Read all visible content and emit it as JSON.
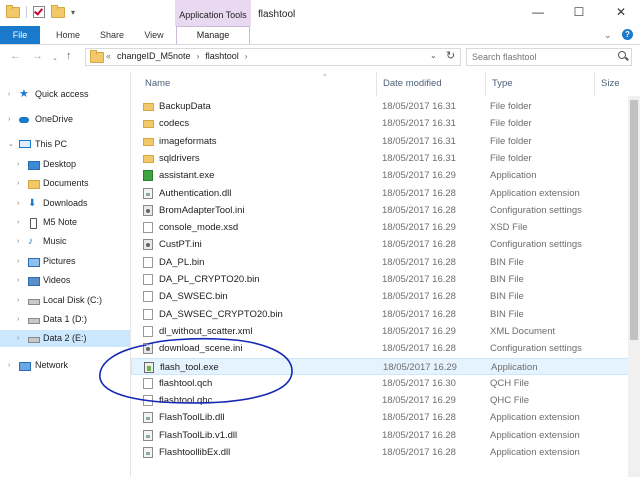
{
  "window": {
    "title": "flashtool",
    "contextual_tab_group": "Application Tools",
    "minimize": "—",
    "maximize": "☐",
    "close": "✕"
  },
  "ribbon": {
    "tabs": [
      "File",
      "Home",
      "Share",
      "View",
      "Manage"
    ]
  },
  "address": {
    "overflow": "«",
    "crumbs": [
      "changeID_M5note",
      "flashtool"
    ],
    "current": "flashtool",
    "search_placeholder": "Search flashtool"
  },
  "nav_pane": {
    "items": [
      {
        "label": "Quick access",
        "icon": "quick-access-star-icon"
      },
      {
        "label": "OneDrive",
        "icon": "onedrive-cloud-icon"
      },
      {
        "label": "This PC",
        "icon": "this-pc-icon"
      },
      {
        "label": "Desktop",
        "icon": "desktop-folder-icon"
      },
      {
        "label": "Documents",
        "icon": "documents-folder-icon"
      },
      {
        "label": "Downloads",
        "icon": "downloads-icon"
      },
      {
        "label": "M5 Note",
        "icon": "phone-device-icon"
      },
      {
        "label": "Music",
        "icon": "music-icon"
      },
      {
        "label": "Pictures",
        "icon": "pictures-folder-icon"
      },
      {
        "label": "Videos",
        "icon": "videos-folder-icon"
      },
      {
        "label": "Local Disk (C:)",
        "icon": "local-disk-icon"
      },
      {
        "label": "Data 1 (D:)",
        "icon": "drive-icon"
      },
      {
        "label": "Data 2 (E:)",
        "icon": "drive-icon"
      },
      {
        "label": "Network",
        "icon": "network-icon"
      }
    ],
    "selected": "Data 2 (E:)"
  },
  "columns": {
    "name": "Name",
    "date": "Date modified",
    "type": "Type",
    "size": "Size"
  },
  "files": [
    {
      "name": "BackupData",
      "date": "18/05/2017 16.31",
      "type": "File folder",
      "icon": "folder-icon"
    },
    {
      "name": "codecs",
      "date": "18/05/2017 16.31",
      "type": "File folder",
      "icon": "folder-icon"
    },
    {
      "name": "imageformats",
      "date": "18/05/2017 16.31",
      "type": "File folder",
      "icon": "folder-icon"
    },
    {
      "name": "sqldrivers",
      "date": "18/05/2017 16.31",
      "type": "File folder",
      "icon": "folder-icon"
    },
    {
      "name": "assistant.exe",
      "date": "18/05/2017 16.29",
      "type": "Application",
      "icon": "qt-app-icon"
    },
    {
      "name": "Authentication.dll",
      "date": "18/05/2017 16.28",
      "type": "Application extension",
      "icon": "dll-icon"
    },
    {
      "name": "BromAdapterTool.ini",
      "date": "18/05/2017 16.28",
      "type": "Configuration settings",
      "icon": "ini-settings-icon"
    },
    {
      "name": "console_mode.xsd",
      "date": "18/05/2017 16.29",
      "type": "XSD File",
      "icon": "file-icon"
    },
    {
      "name": "CustPT.ini",
      "date": "18/05/2017 16.28",
      "type": "Configuration settings",
      "icon": "ini-settings-icon"
    },
    {
      "name": "DA_PL.bin",
      "date": "18/05/2017 16.28",
      "type": "BIN File",
      "icon": "file-icon"
    },
    {
      "name": "DA_PL_CRYPTO20.bin",
      "date": "18/05/2017 16.28",
      "type": "BIN File",
      "icon": "file-icon"
    },
    {
      "name": "DA_SWSEC.bin",
      "date": "18/05/2017 16.28",
      "type": "BIN File",
      "icon": "file-icon"
    },
    {
      "name": "DA_SWSEC_CRYPTO20.bin",
      "date": "18/05/2017 16.28",
      "type": "BIN File",
      "icon": "file-icon"
    },
    {
      "name": "dl_without_scatter.xml",
      "date": "18/05/2017 16.29",
      "type": "XML Document",
      "icon": "file-icon"
    },
    {
      "name": "download_scene.ini",
      "date": "18/05/2017 16.28",
      "type": "Configuration settings",
      "icon": "ini-settings-icon"
    },
    {
      "name": "flash_tool.exe",
      "date": "18/05/2017 16.29",
      "type": "Application",
      "icon": "flash-tool-exe-icon"
    },
    {
      "name": "flashtool.qch",
      "date": "18/05/2017 16.30",
      "type": "QCH File",
      "icon": "file-icon"
    },
    {
      "name": "flashtool.qhc",
      "date": "18/05/2017 16.29",
      "type": "QHC File",
      "icon": "file-icon"
    },
    {
      "name": "FlashToolLib.dll",
      "date": "18/05/2017 16.28",
      "type": "Application extension",
      "icon": "dll-icon"
    },
    {
      "name": "FlashToolLib.v1.dll",
      "date": "18/05/2017 16.28",
      "type": "Application extension",
      "icon": "dll-icon"
    },
    {
      "name": "FlashtoollibEx.dll",
      "date": "18/05/2017 16.28",
      "type": "Application extension",
      "icon": "dll-icon"
    }
  ],
  "selected_file": "flash_tool.exe",
  "annotation": {
    "color": "#1428b4"
  }
}
